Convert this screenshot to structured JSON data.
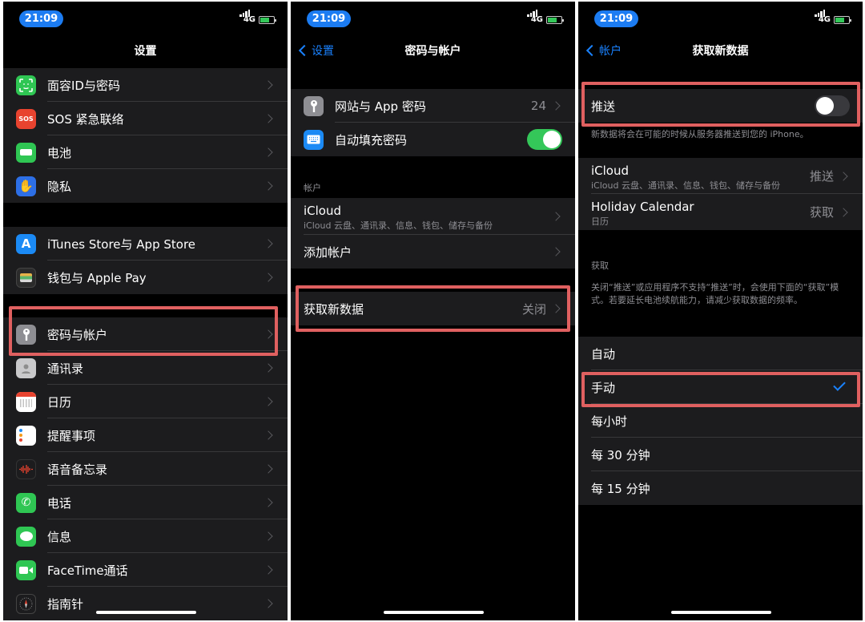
{
  "status": {
    "time": "21:09",
    "network": "4G"
  },
  "colors": {
    "accent": "#1a82ff",
    "highlight": "#e06060",
    "toggle_on": "#34c759"
  },
  "screen1": {
    "title": "设置",
    "items": [
      {
        "label": "面容ID与密码",
        "icon": "face-id-icon"
      },
      {
        "label": "SOS 紧急联络",
        "icon": "sos-icon",
        "icon_text": "SOS"
      },
      {
        "label": "电池",
        "icon": "battery-icon"
      },
      {
        "label": "隐私",
        "icon": "hand-icon"
      },
      {
        "label": "iTunes Store与 App Store",
        "icon": "app-store-icon"
      },
      {
        "label": "钱包与 Apple Pay",
        "icon": "wallet-icon"
      },
      {
        "label": "密码与帐户",
        "icon": "key-icon"
      },
      {
        "label": "通讯录",
        "icon": "contacts-icon"
      },
      {
        "label": "日历",
        "icon": "calendar-icon"
      },
      {
        "label": "提醒事项",
        "icon": "reminders-icon"
      },
      {
        "label": "语音备忘录",
        "icon": "voice-memos-icon"
      },
      {
        "label": "电话",
        "icon": "phone-icon"
      },
      {
        "label": "信息",
        "icon": "messages-icon"
      },
      {
        "label": "FaceTime通话",
        "icon": "facetime-icon"
      },
      {
        "label": "指南针",
        "icon": "compass-icon"
      }
    ]
  },
  "screen2": {
    "back": "设置",
    "title": "密码与帐户",
    "website_passwords": {
      "label": "网站与 App 密码",
      "value": "24"
    },
    "autofill": {
      "label": "自动填充密码",
      "on": true
    },
    "accounts_header": "帐户",
    "icloud": {
      "label": "iCloud",
      "sub": "iCloud 云盘、通讯录、信息、钱包、储存与备份"
    },
    "add_account": "添加帐户",
    "fetch": {
      "label": "获取新数据",
      "value": "关闭"
    }
  },
  "screen3": {
    "back": "帐户",
    "title": "获取新数据",
    "push": {
      "label": "推送",
      "on": false
    },
    "push_note": "新数据将会在可能的时候从服务器推送到您的 iPhone。",
    "accounts": [
      {
        "label": "iCloud",
        "sub": "iCloud 云盘、通讯录、信息、钱包、储存与备份",
        "value": "推送"
      },
      {
        "label": "Holiday Calendar",
        "sub": "日历",
        "value": "获取"
      }
    ],
    "fetch_header": "获取",
    "fetch_note": "关闭“推送”或应用程序不支持“推送”时，会使用下面的“获取”模式。若要延长电池续航能力，请减少获取数据的频率。",
    "options": [
      {
        "label": "自动",
        "selected": false
      },
      {
        "label": "手动",
        "selected": true
      },
      {
        "label": "每小时",
        "selected": false
      },
      {
        "label": "每 30 分钟",
        "selected": false
      },
      {
        "label": "每 15 分钟",
        "selected": false
      }
    ]
  }
}
